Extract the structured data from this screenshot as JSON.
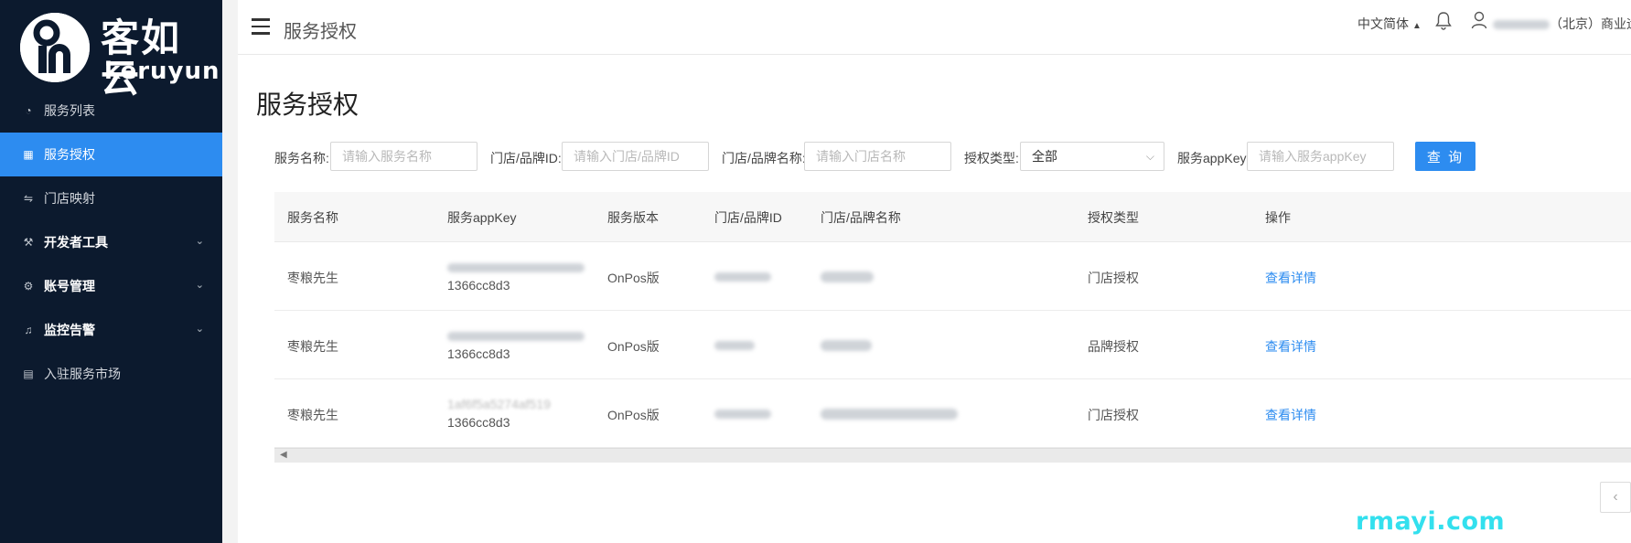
{
  "brand": {
    "name": "客如云",
    "sub": "keruyun"
  },
  "sidebar": {
    "items": [
      {
        "label": "服务列表",
        "icon": "dashboard-icon",
        "glyph": "◔"
      },
      {
        "label": "服务授权",
        "icon": "grid-icon",
        "glyph": "▦",
        "active": true
      },
      {
        "label": "门店映射",
        "icon": "swap-icon",
        "glyph": "⇋"
      },
      {
        "label": "开发者工具",
        "icon": "wrench-icon",
        "glyph": "⚒",
        "expandable": true
      },
      {
        "label": "账号管理",
        "icon": "gear-icon",
        "glyph": "⚙",
        "expandable": true
      },
      {
        "label": "监控告警",
        "icon": "bell-icon",
        "glyph": "♫",
        "expandable": true
      },
      {
        "label": "入驻服务市场",
        "icon": "building-icon",
        "glyph": "▤"
      }
    ]
  },
  "header": {
    "title": "服务授权",
    "language": "中文简体",
    "user_suffix": "（北京）商业运"
  },
  "page": {
    "title": "服务授权"
  },
  "filters": {
    "service_name_label": "服务名称:",
    "service_name_placeholder": "请输入服务名称",
    "store_id_label": "门店/品牌ID:",
    "store_id_placeholder": "请输入门店/品牌ID",
    "store_name_label": "门店/品牌名称:",
    "store_name_placeholder": "请输入门店名称",
    "auth_type_label": "授权类型:",
    "auth_type_value": "全部",
    "appkey_label": "服务appKey:",
    "appkey_placeholder": "请输入服务appKey",
    "query_button": "查 询"
  },
  "table": {
    "columns": [
      "服务名称",
      "服务appKey",
      "服务版本",
      "门店/品牌ID",
      "门店/品牌名称",
      "授权类型",
      "操作"
    ],
    "rows": [
      {
        "service_name": "枣粮先生",
        "appkey_line2": "1366cc8d3",
        "version": "OnPos版",
        "auth_type": "门店授权",
        "action": "查看详情"
      },
      {
        "service_name": "枣粮先生",
        "appkey_line2": "1366cc8d3",
        "version": "OnPos版",
        "auth_type": "品牌授权",
        "action": "查看详情"
      },
      {
        "service_name": "枣粮先生",
        "appkey_line1": "1af6f5a5274af519",
        "appkey_line2": "1366cc8d3",
        "version": "OnPos版",
        "auth_type": "门店授权",
        "action": "查看详情"
      }
    ]
  },
  "watermark": "rmayi.com",
  "colors": {
    "sidebar_bg": "#0c1a2e",
    "accent": "#2d8cf0",
    "link": "#2d8cf0"
  }
}
